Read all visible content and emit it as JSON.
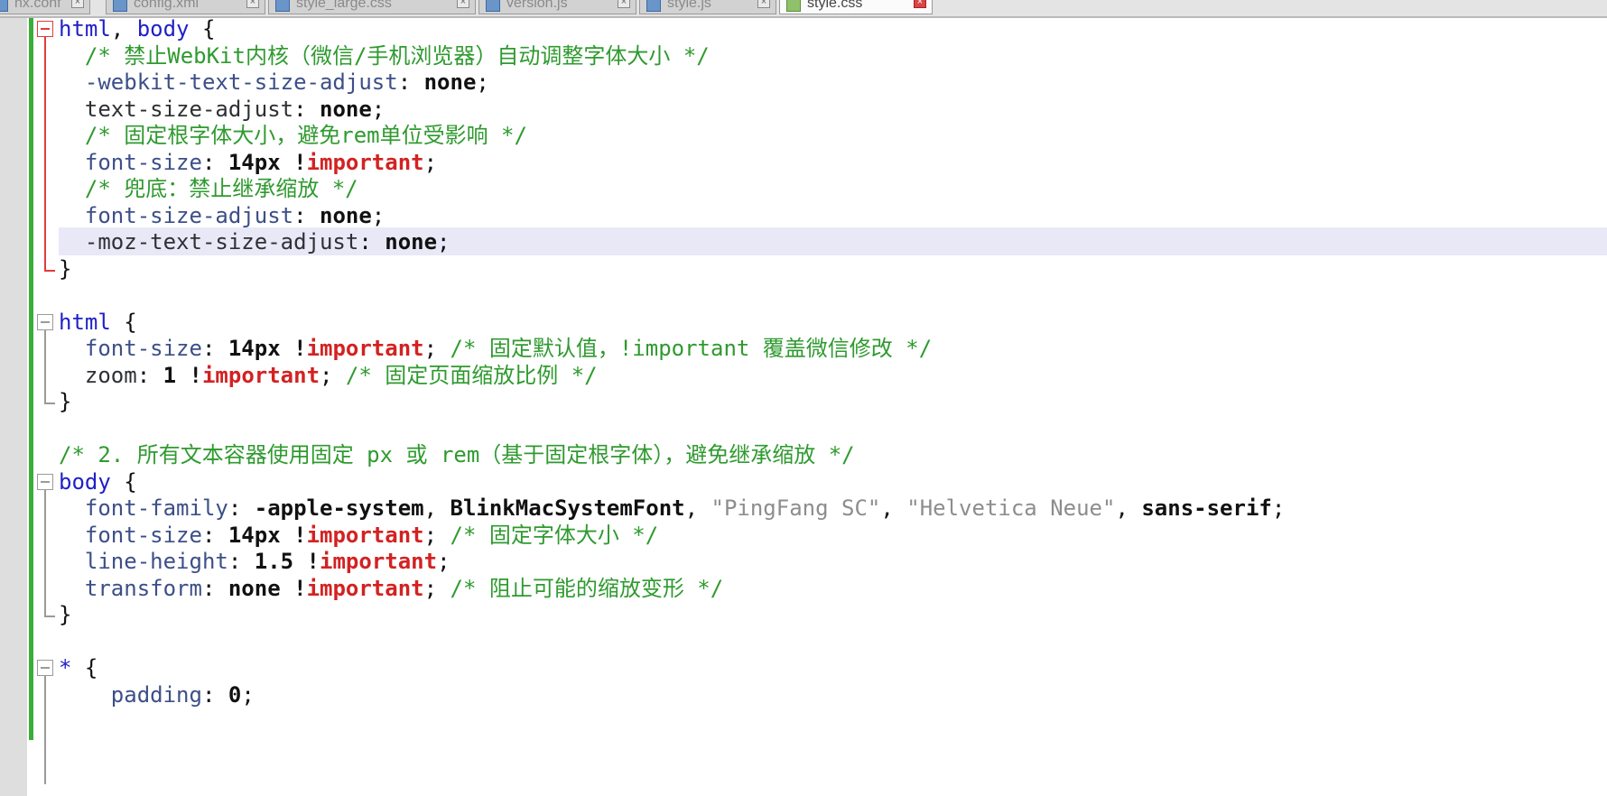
{
  "tabs": [
    {
      "label": "nx.conf",
      "active": false
    },
    {
      "label": "config.xml",
      "active": false
    },
    {
      "label": "style_large.css",
      "active": false
    },
    {
      "label": "version.js",
      "active": false
    },
    {
      "label": "style.js",
      "active": false
    },
    {
      "label": "style.css",
      "active": true
    }
  ],
  "editor": {
    "lines": [
      [
        {
          "t": "html",
          "c": "kw-sel"
        },
        {
          "t": ", ",
          "c": "t"
        },
        {
          "t": "body",
          "c": "kw-sel"
        },
        {
          "t": " {",
          "c": "t"
        }
      ],
      [
        {
          "t": "  /* 禁止WebKit内核（微信/手机浏览器）自动调整字体大小 */",
          "c": "c"
        }
      ],
      [
        {
          "t": "  -webkit-text-size-adjust",
          "c": "p"
        },
        {
          "t": ": ",
          "c": "t"
        },
        {
          "t": "none",
          "c": "v"
        },
        {
          "t": ";",
          "c": "t"
        }
      ],
      [
        {
          "t": "  text-size-adjust",
          "c": "pb"
        },
        {
          "t": ": ",
          "c": "t"
        },
        {
          "t": "none",
          "c": "v"
        },
        {
          "t": ";",
          "c": "t"
        }
      ],
      [
        {
          "t": "  /* 固定根字体大小，避免rem单位受影响 */",
          "c": "c"
        }
      ],
      [
        {
          "t": "  font-size",
          "c": "p"
        },
        {
          "t": ": ",
          "c": "t"
        },
        {
          "t": "14px",
          "c": "v"
        },
        {
          "t": " !",
          "c": "v"
        },
        {
          "t": "important",
          "c": "imp"
        },
        {
          "t": ";",
          "c": "t"
        }
      ],
      [
        {
          "t": "  /* 兜底：禁止继承缩放 */",
          "c": "c"
        }
      ],
      [
        {
          "t": "  font-size-adjust",
          "c": "p"
        },
        {
          "t": ": ",
          "c": "t"
        },
        {
          "t": "none",
          "c": "v"
        },
        {
          "t": ";",
          "c": "t"
        }
      ],
      [
        {
          "t": "  -moz-text-size-adjust",
          "c": "pb"
        },
        {
          "t": ": ",
          "c": "t"
        },
        {
          "t": "none",
          "c": "v"
        },
        {
          "t": ";",
          "c": "t"
        }
      ],
      [
        {
          "t": "}",
          "c": "t"
        }
      ],
      [],
      [
        {
          "t": "html",
          "c": "kw-sel"
        },
        {
          "t": " {",
          "c": "t"
        }
      ],
      [
        {
          "t": "  font-size",
          "c": "p"
        },
        {
          "t": ": ",
          "c": "t"
        },
        {
          "t": "14px",
          "c": "v"
        },
        {
          "t": " !",
          "c": "v"
        },
        {
          "t": "important",
          "c": "imp"
        },
        {
          "t": "; ",
          "c": "t"
        },
        {
          "t": "/* 固定默认值，!important 覆盖微信修改 */",
          "c": "c"
        }
      ],
      [
        {
          "t": "  zoom",
          "c": "pb"
        },
        {
          "t": ": ",
          "c": "t"
        },
        {
          "t": "1",
          "c": "v"
        },
        {
          "t": " !",
          "c": "v"
        },
        {
          "t": "important",
          "c": "imp"
        },
        {
          "t": "; ",
          "c": "t"
        },
        {
          "t": "/* 固定页面缩放比例 */",
          "c": "c"
        }
      ],
      [
        {
          "t": "}",
          "c": "t"
        }
      ],
      [],
      [
        {
          "t": "/* 2. 所有文本容器使用固定 px 或 rem（基于固定根字体），避免继承缩放 */",
          "c": "c"
        }
      ],
      [
        {
          "t": "body",
          "c": "kw-sel"
        },
        {
          "t": " {",
          "c": "t"
        }
      ],
      [
        {
          "t": "  font-family",
          "c": "p"
        },
        {
          "t": ": ",
          "c": "t"
        },
        {
          "t": "-apple-system",
          "c": "v"
        },
        {
          "t": ", ",
          "c": "t"
        },
        {
          "t": "BlinkMacSystemFont",
          "c": "v"
        },
        {
          "t": ", ",
          "c": "t"
        },
        {
          "t": "\"PingFang SC\"",
          "c": "s"
        },
        {
          "t": ", ",
          "c": "t"
        },
        {
          "t": "\"Helvetica Neue\"",
          "c": "s"
        },
        {
          "t": ", ",
          "c": "t"
        },
        {
          "t": "sans-serif",
          "c": "v"
        },
        {
          "t": ";",
          "c": "t"
        }
      ],
      [
        {
          "t": "  font-size",
          "c": "p"
        },
        {
          "t": ": ",
          "c": "t"
        },
        {
          "t": "14px",
          "c": "v"
        },
        {
          "t": " !",
          "c": "v"
        },
        {
          "t": "important",
          "c": "imp"
        },
        {
          "t": "; ",
          "c": "t"
        },
        {
          "t": "/* 固定字体大小 */",
          "c": "c"
        }
      ],
      [
        {
          "t": "  line-height",
          "c": "p"
        },
        {
          "t": ": ",
          "c": "t"
        },
        {
          "t": "1.5",
          "c": "v"
        },
        {
          "t": " !",
          "c": "v"
        },
        {
          "t": "important",
          "c": "imp"
        },
        {
          "t": ";",
          "c": "t"
        }
      ],
      [
        {
          "t": "  transform",
          "c": "p"
        },
        {
          "t": ": ",
          "c": "t"
        },
        {
          "t": "none",
          "c": "v"
        },
        {
          "t": " !",
          "c": "v"
        },
        {
          "t": "important",
          "c": "imp"
        },
        {
          "t": "; ",
          "c": "t"
        },
        {
          "t": "/* 阻止可能的缩放变形 */",
          "c": "c"
        }
      ],
      [
        {
          "t": "}",
          "c": "t"
        }
      ],
      [],
      [
        {
          "t": "*",
          "c": "kw-sel"
        },
        {
          "t": " {",
          "c": "t"
        }
      ],
      [
        {
          "t": "    padding",
          "c": "p"
        },
        {
          "t": ": ",
          "c": "t"
        },
        {
          "t": "0",
          "c": "v"
        },
        {
          "t": ";",
          "c": "t"
        }
      ]
    ]
  }
}
